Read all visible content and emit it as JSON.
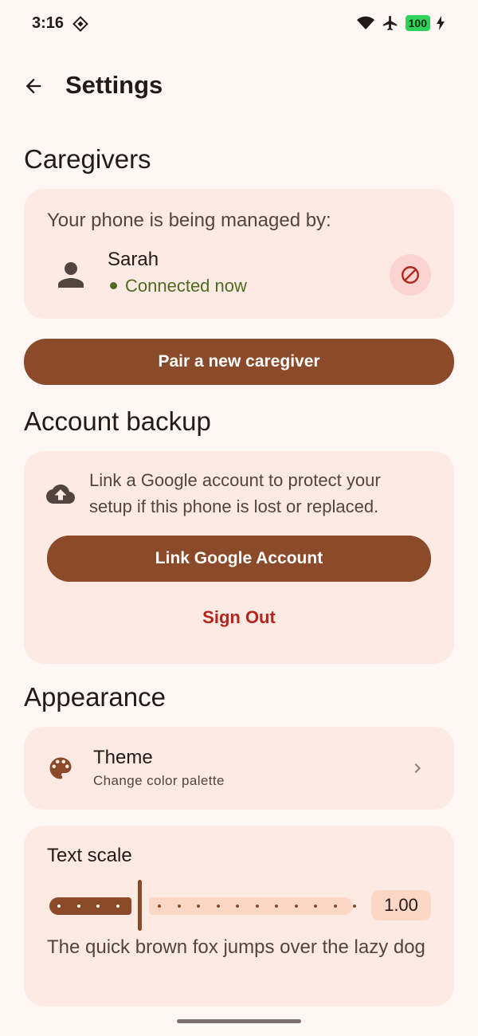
{
  "status_bar": {
    "time": "3:16",
    "battery": "100",
    "icons": [
      "widget-icon",
      "wifi-icon",
      "airplane-icon",
      "battery-icon",
      "charging-bolt-icon"
    ]
  },
  "header": {
    "title": "Settings",
    "back_icon": "arrow-back-icon"
  },
  "caregivers": {
    "section_title": "Caregivers",
    "managed_label": "Your phone is being managed by:",
    "caregiver": {
      "name": "Sarah",
      "status": "Connected now",
      "status_color": "#4f6a21",
      "avatar_icon": "person-icon",
      "remove_icon": "block-icon"
    },
    "pair_button": "Pair a new caregiver"
  },
  "account_backup": {
    "section_title": "Account backup",
    "description": "Link a Google account to protect your setup if this phone is lost or replaced.",
    "icon": "cloud-upload-icon",
    "link_button": "Link Google Account",
    "sign_out": "Sign Out"
  },
  "appearance": {
    "section_title": "Appearance",
    "theme": {
      "title": "Theme",
      "subtitle": "Change color palette",
      "icon": "palette-icon"
    },
    "text_scale": {
      "label": "Text scale",
      "value": "1.00",
      "slider_fraction": 0.3,
      "sample": "The quick brown fox jumps over the lazy dog"
    }
  },
  "colors": {
    "background": "#fff7f3",
    "card": "#fdeae3",
    "primary": "#8b4a29",
    "error": "#b3261e",
    "on_surface": "#231917"
  }
}
